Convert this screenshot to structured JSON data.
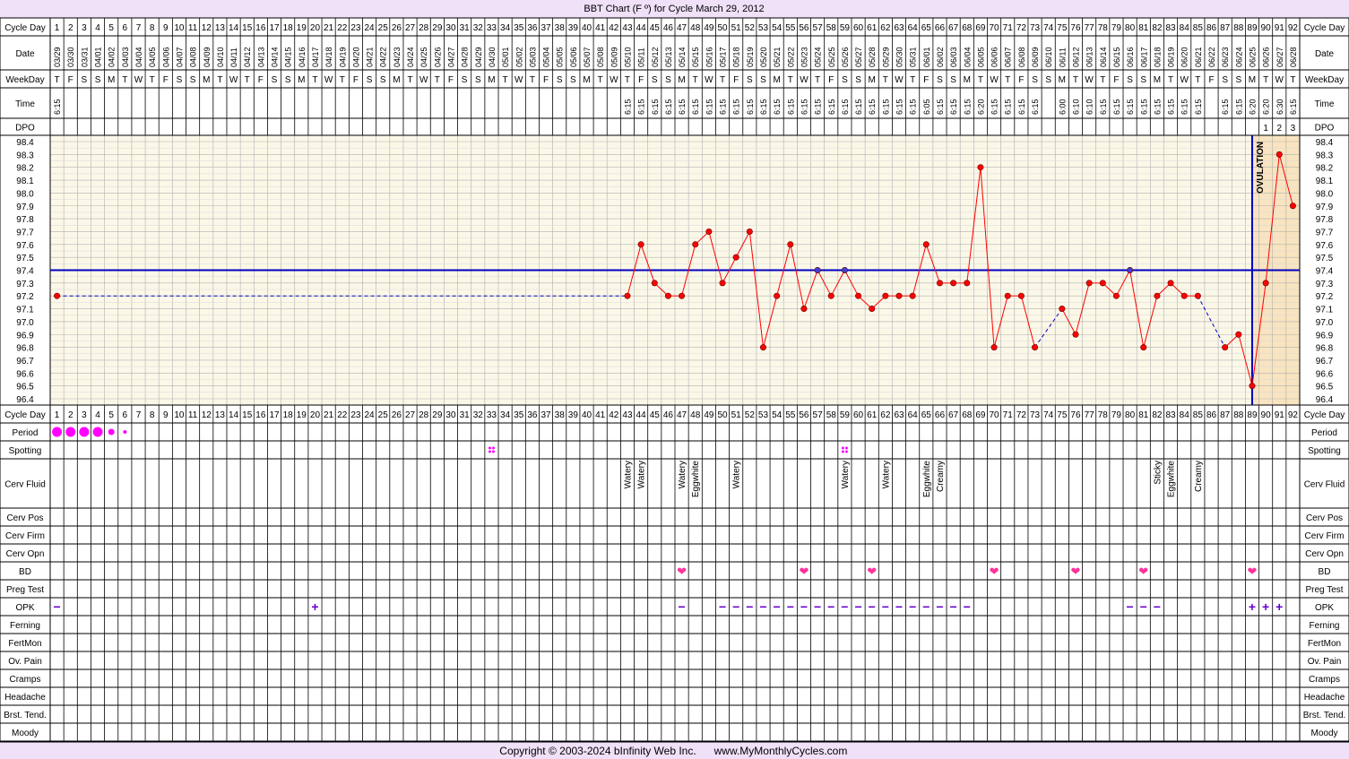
{
  "title": "BBT Chart (F º) for Cycle March 29, 2012",
  "footer": {
    "copyright": "Copyright © 2003-2024 bInfinity Web Inc.",
    "site": "www.MyMonthlyCycles.com"
  },
  "colors": {
    "background": "#f0e0f8",
    "chart_bg": "#fbf8e8",
    "temp_line": "#ff0000",
    "coverline": "#0000c0",
    "ovulation_band": "#f8e4c0",
    "period": "#ff00ff",
    "heart": "#ff3399",
    "opk": "#6600cc"
  },
  "chart_data": {
    "type": "line",
    "title": "BBT Chart (F º) for Cycle March 29, 2012",
    "ylim": [
      96.4,
      98.4
    ],
    "y_ticks": [
      "98.4",
      "98.3",
      "98.2",
      "98.1",
      "98.0",
      "97.9",
      "97.8",
      "97.7",
      "97.6",
      "97.5",
      "97.4",
      "97.3",
      "97.2",
      "97.1",
      "97.0",
      "96.9",
      "96.8",
      "96.7",
      "96.6",
      "96.5",
      "96.4"
    ],
    "grid": true,
    "coverline": 97.4,
    "ovulation_day": 89,
    "ovulation_label": "OVULATION",
    "days": [
      1,
      2,
      3,
      4,
      5,
      6,
      7,
      8,
      9,
      10,
      11,
      12,
      13,
      14,
      15,
      16,
      17,
      18,
      19,
      20,
      21,
      22,
      23,
      24,
      25,
      26,
      27,
      28,
      29,
      30,
      31,
      32,
      33,
      34,
      35,
      36,
      37,
      38,
      39,
      40,
      41,
      42,
      43,
      44,
      45,
      46,
      47,
      48,
      49,
      50,
      51,
      52,
      53,
      54,
      55,
      56,
      57,
      58,
      59,
      60,
      61,
      62,
      63,
      64,
      65,
      66,
      67,
      68,
      69,
      70,
      71,
      72,
      73,
      74,
      75,
      76,
      77,
      78,
      79,
      80,
      81,
      82,
      83,
      84,
      85,
      86,
      87,
      88,
      89,
      90,
      91,
      92
    ],
    "dates": [
      "03/29",
      "03/30",
      "03/31",
      "04/01",
      "04/02",
      "04/03",
      "04/04",
      "04/05",
      "04/06",
      "04/07",
      "04/08",
      "04/09",
      "04/10",
      "04/11",
      "04/12",
      "04/13",
      "04/14",
      "04/15",
      "04/16",
      "04/17",
      "04/18",
      "04/19",
      "04/20",
      "04/21",
      "04/22",
      "04/23",
      "04/24",
      "04/25",
      "04/26",
      "04/27",
      "04/28",
      "04/29",
      "04/30",
      "05/01",
      "05/02",
      "05/03",
      "05/04",
      "05/05",
      "05/06",
      "05/07",
      "05/08",
      "05/09",
      "05/10",
      "05/11",
      "05/12",
      "05/13",
      "05/14",
      "05/15",
      "05/16",
      "05/17",
      "05/18",
      "05/19",
      "05/20",
      "05/21",
      "05/22",
      "05/23",
      "05/24",
      "05/25",
      "05/26",
      "05/27",
      "05/28",
      "05/29",
      "05/30",
      "05/31",
      "06/01",
      "06/02",
      "06/03",
      "06/04",
      "06/05",
      "06/06",
      "06/07",
      "06/08",
      "06/09",
      "06/10",
      "06/11",
      "06/12",
      "06/13",
      "06/14",
      "06/15",
      "06/16",
      "06/17",
      "06/18",
      "06/19",
      "06/20",
      "06/21",
      "06/22",
      "06/23",
      "06/24",
      "06/25",
      "06/26",
      "06/27",
      "06/28"
    ],
    "weekdays": [
      "T",
      "F",
      "S",
      "S",
      "M",
      "T",
      "W",
      "T",
      "F",
      "S",
      "S",
      "M",
      "T",
      "W",
      "T",
      "F",
      "S",
      "S",
      "M",
      "T",
      "W",
      "T",
      "F",
      "S",
      "S",
      "M",
      "T",
      "W",
      "T",
      "F",
      "S",
      "S",
      "M",
      "T",
      "W",
      "T",
      "F",
      "S",
      "S",
      "M",
      "T",
      "W",
      "T",
      "F",
      "S",
      "S",
      "M",
      "T",
      "W",
      "T",
      "F",
      "S",
      "S",
      "M",
      "T",
      "W",
      "T",
      "F",
      "S",
      "S",
      "M",
      "T",
      "W",
      "T",
      "F",
      "S",
      "S",
      "M",
      "T",
      "W",
      "T",
      "F",
      "S",
      "S",
      "M",
      "T",
      "W",
      "T",
      "F",
      "S",
      "S",
      "M",
      "T",
      "W",
      "T",
      "F",
      "S",
      "S",
      "M",
      "T",
      "W",
      "T"
    ],
    "times": {
      "1": "6:15",
      "43": "6:15",
      "44": "6:15",
      "45": "6:15",
      "46": "6:15",
      "47": "6:15",
      "48": "6:15",
      "49": "6:15",
      "50": "6:15",
      "51": "6:15",
      "52": "6:15",
      "53": "6:15",
      "54": "6:15",
      "55": "6:15",
      "56": "6:15",
      "57": "6:15",
      "58": "6:15",
      "59": "6:15",
      "60": "6:15",
      "61": "6:15",
      "62": "6:15",
      "63": "6:15",
      "64": "6:15",
      "65": "6:05",
      "66": "6:15",
      "67": "6:15",
      "68": "6:15",
      "69": "6:20",
      "70": "6:15",
      "71": "6:15",
      "72": "6:15",
      "73": "6:15",
      "75": "6:00",
      "76": "6:10",
      "77": "6:10",
      "78": "6:15",
      "79": "6:15",
      "80": "6:15",
      "81": "6:15",
      "82": "6:15",
      "83": "6:15",
      "84": "6:15",
      "85": "6:15",
      "87": "6:15",
      "88": "6:15",
      "89": "6:20",
      "90": "6:20",
      "91": "6:30",
      "92": "6:15"
    },
    "dpo": {
      "90": "1",
      "91": "2",
      "92": "3"
    },
    "temps": [
      {
        "day": 1,
        "temp": 97.2
      },
      {
        "day": 43,
        "temp": 97.2
      },
      {
        "day": 44,
        "temp": 97.6
      },
      {
        "day": 45,
        "temp": 97.3
      },
      {
        "day": 46,
        "temp": 97.2
      },
      {
        "day": 47,
        "temp": 97.2
      },
      {
        "day": 48,
        "temp": 97.6
      },
      {
        "day": 49,
        "temp": 97.7
      },
      {
        "day": 50,
        "temp": 97.3
      },
      {
        "day": 51,
        "temp": 97.5
      },
      {
        "day": 52,
        "temp": 97.7
      },
      {
        "day": 53,
        "temp": 96.8
      },
      {
        "day": 54,
        "temp": 97.2
      },
      {
        "day": 55,
        "temp": 97.6
      },
      {
        "day": 56,
        "temp": 97.1
      },
      {
        "day": 57,
        "temp": 97.4,
        "mark": "blue"
      },
      {
        "day": 58,
        "temp": 97.2
      },
      {
        "day": 59,
        "temp": 97.4,
        "mark": "blue"
      },
      {
        "day": 60,
        "temp": 97.2
      },
      {
        "day": 61,
        "temp": 97.1
      },
      {
        "day": 62,
        "temp": 97.2
      },
      {
        "day": 63,
        "temp": 97.2
      },
      {
        "day": 64,
        "temp": 97.2
      },
      {
        "day": 65,
        "temp": 97.6
      },
      {
        "day": 66,
        "temp": 97.3
      },
      {
        "day": 67,
        "temp": 97.3
      },
      {
        "day": 68,
        "temp": 97.3
      },
      {
        "day": 69,
        "temp": 98.2
      },
      {
        "day": 70,
        "temp": 96.8
      },
      {
        "day": 71,
        "temp": 97.2
      },
      {
        "day": 72,
        "temp": 97.2
      },
      {
        "day": 73,
        "temp": 96.8
      },
      {
        "day": 75,
        "temp": 97.1
      },
      {
        "day": 76,
        "temp": 96.9
      },
      {
        "day": 77,
        "temp": 97.3
      },
      {
        "day": 78,
        "temp": 97.3
      },
      {
        "day": 79,
        "temp": 97.2
      },
      {
        "day": 80,
        "temp": 97.4,
        "mark": "blue"
      },
      {
        "day": 81,
        "temp": 96.8
      },
      {
        "day": 82,
        "temp": 97.2
      },
      {
        "day": 83,
        "temp": 97.3
      },
      {
        "day": 84,
        "temp": 97.2
      },
      {
        "day": 85,
        "temp": 97.2
      },
      {
        "day": 87,
        "temp": 96.8
      },
      {
        "day": 88,
        "temp": 96.9
      },
      {
        "day": 89,
        "temp": 96.5
      },
      {
        "day": 90,
        "temp": 97.3
      },
      {
        "day": 91,
        "temp": 98.3
      },
      {
        "day": 92,
        "temp": 97.9
      }
    ]
  },
  "rows": [
    {
      "key": "period",
      "label": "Period"
    },
    {
      "key": "spotting",
      "label": "Spotting"
    },
    {
      "key": "cervfluid",
      "label": "Cerv Fluid"
    },
    {
      "key": "cervpos",
      "label": "Cerv Pos"
    },
    {
      "key": "cervfirm",
      "label": "Cerv Firm"
    },
    {
      "key": "cervopn",
      "label": "Cerv Opn"
    },
    {
      "key": "bd",
      "label": "BD"
    },
    {
      "key": "pregtest",
      "label": "Preg Test"
    },
    {
      "key": "opk",
      "label": "OPK"
    },
    {
      "key": "ferning",
      "label": "Ferning"
    },
    {
      "key": "fertmon",
      "label": "FertMon"
    },
    {
      "key": "ovpain",
      "label": "Ov. Pain"
    },
    {
      "key": "cramps",
      "label": "Cramps"
    },
    {
      "key": "headache",
      "label": "Headache"
    },
    {
      "key": "brsttend",
      "label": "Brst. Tend."
    },
    {
      "key": "moody",
      "label": "Moody"
    }
  ],
  "header_labels": {
    "cycle_day": "Cycle Day",
    "date": "Date",
    "weekday": "WeekDay",
    "time": "Time",
    "dpo": "DPO"
  },
  "period": {
    "1": "heavy",
    "2": "heavy",
    "3": "heavy",
    "4": "heavy",
    "5": "medium",
    "6": "light"
  },
  "spotting": [
    33,
    59
  ],
  "cerv_fluid": {
    "43": "Watery",
    "44": "Watery",
    "47": "Watery",
    "48": "Eggwhite",
    "51": "Watery",
    "59": "Watery",
    "62": "Watery",
    "65": "Eggwhite",
    "66": "Creamy",
    "82": "Sticky",
    "83": "Eggwhite",
    "85": "Creamy"
  },
  "bd": [
    47,
    56,
    61,
    70,
    76,
    81,
    89
  ],
  "opk": {
    "1": "−",
    "20": "+",
    "47": "−",
    "50": "−",
    "51": "−",
    "52": "−",
    "53": "−",
    "54": "−",
    "55": "−",
    "56": "−",
    "57": "−",
    "58": "−",
    "59": "−",
    "60": "−",
    "61": "−",
    "62": "−",
    "63": "−",
    "64": "−",
    "65": "−",
    "66": "−",
    "67": "−",
    "68": "−",
    "80": "−",
    "81": "−",
    "82": "−",
    "89": "+",
    "90": "+",
    "91": "+"
  }
}
